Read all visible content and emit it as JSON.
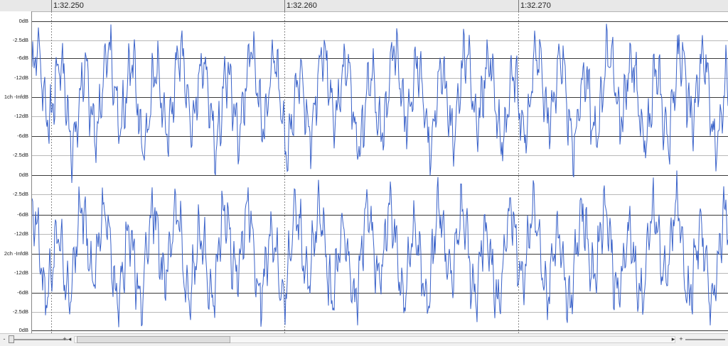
{
  "ruler": {
    "ticks": [
      {
        "label": "1:32.250"
      },
      {
        "label": "1:32.260"
      },
      {
        "label": "1:32.270"
      }
    ]
  },
  "channels": [
    {
      "labels": [
        "0dB",
        "-2.5dB",
        "-6dB",
        "-12dB",
        "1ch -InfdB",
        "-12dB",
        "-6dB",
        "-2.5dB"
      ]
    },
    {
      "labels": [
        "0dB",
        "-2.5dB",
        "-6dB",
        "-12dB",
        "2ch -InfdB",
        "-12dB",
        "-6dB",
        "-2.5dB",
        "0dB"
      ]
    }
  ],
  "scrollbar": {
    "zoom_out_label": "-",
    "zoom_in_label": "+",
    "scroll_left_label": "◂",
    "scroll_right_label": "▸",
    "zoom_out_label_2": "+"
  },
  "colors": {
    "waveform": "#3a62c9",
    "grid_major": "#3a3a3a",
    "grid_minor": "#b8b8b8",
    "marker": "#888888"
  }
}
